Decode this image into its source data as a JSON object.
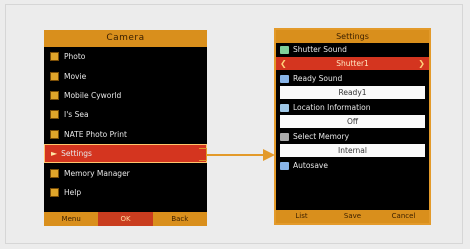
{
  "camera_menu": {
    "title": "Camera",
    "items": [
      {
        "label": "Photo"
      },
      {
        "label": "Movie"
      },
      {
        "label": "Mobile Cyworld"
      },
      {
        "label": "I's Sea"
      },
      {
        "label": "NATE Photo Print"
      },
      {
        "label": "Settings",
        "selected": true
      },
      {
        "label": "Memory Manager"
      },
      {
        "label": "Help"
      }
    ],
    "softkeys": {
      "left": "Menu",
      "center": "OK",
      "right": "Back"
    }
  },
  "settings": {
    "title": "Settings",
    "rows": [
      {
        "label": "Shutter Sound",
        "value": "Shutter1",
        "icon": "shutter-sound-icon",
        "active": true
      },
      {
        "label": "Ready Sound",
        "value": "Ready1",
        "icon": "ready-sound-icon"
      },
      {
        "label": "Location Information",
        "value": "Off",
        "icon": "location-icon"
      },
      {
        "label": "Select Memory",
        "value": "Internal",
        "icon": "memory-icon"
      },
      {
        "label": "Autosave",
        "icon": "autosave-icon"
      }
    ],
    "softkeys": {
      "left": "List",
      "center": "Save",
      "right": "Cancel"
    }
  },
  "colors": {
    "accent": "#d98f1c",
    "highlight": "#d4351f",
    "arrow": "#e39a2a",
    "screen_bg": "#000000"
  }
}
